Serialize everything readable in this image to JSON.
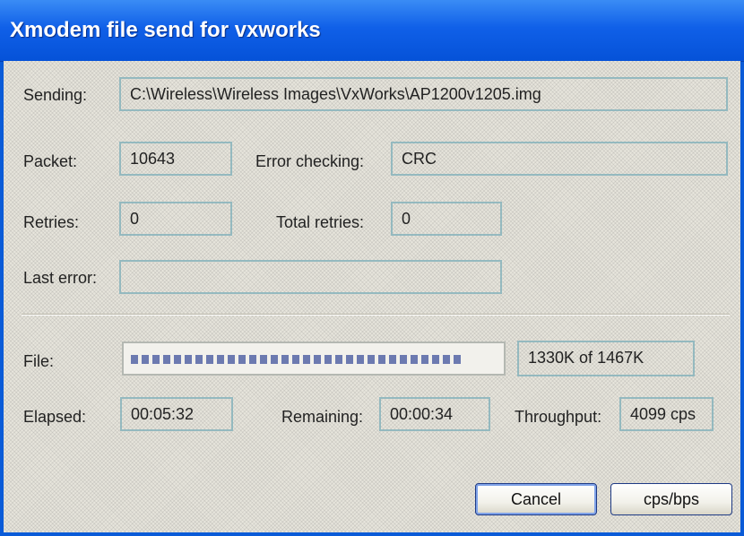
{
  "window": {
    "title": "Xmodem file send for vxworks"
  },
  "fields": {
    "sending_label": "Sending:",
    "sending_value": "C:\\Wireless\\Wireless Images\\VxWorks\\AP1200v1205.img",
    "packet_label": "Packet:",
    "packet_value": "10643",
    "error_checking_label": "Error checking:",
    "error_checking_value": "CRC",
    "retries_label": "Retries:",
    "retries_value": "0",
    "total_retries_label": "Total retries:",
    "total_retries_value": "0",
    "last_error_label": "Last error:",
    "last_error_value": ""
  },
  "transfer": {
    "file_label": "File:",
    "progress_fraction": 0.9066,
    "file_size_text": "1330K of 1467K",
    "elapsed_label": "Elapsed:",
    "elapsed_value": "00:05:32",
    "remaining_label": "Remaining:",
    "remaining_value": "00:00:34",
    "throughput_label": "Throughput:",
    "throughput_value": "4099 cps"
  },
  "buttons": {
    "cancel_label": "Cancel",
    "cps_bps_label": "cps/bps"
  },
  "colors": {
    "titlebar": "#0a5bd8",
    "field_border": "#94b9bf",
    "progress_fill": "#6c7ab0"
  }
}
